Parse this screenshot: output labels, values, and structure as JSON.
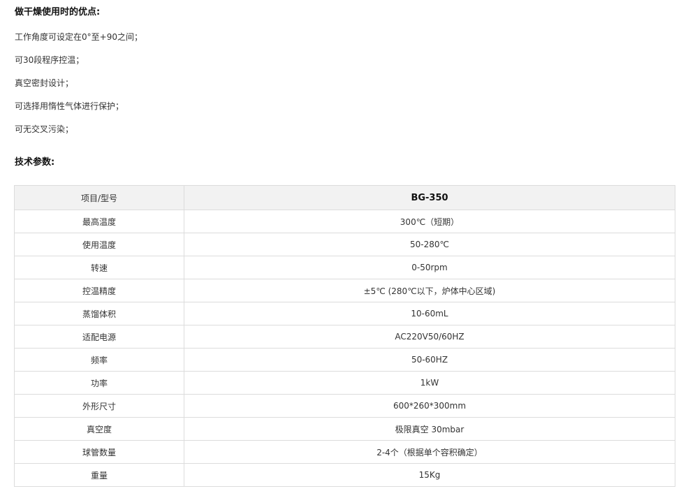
{
  "advantages": {
    "title": "做干燥使用时的优点:",
    "items": [
      "工作角度可设定在0°至+90之间；",
      "可30段程序控温；",
      "真空密封设计；",
      "可选择用惰性气体进行保护；",
      "可无交叉污染；"
    ]
  },
  "specs": {
    "title": "技术参数:",
    "header": {
      "label": "项目/型号",
      "model": "BG-350"
    },
    "rows": [
      {
        "label": "最高温度",
        "value": "300℃（短期）"
      },
      {
        "label": "使用温度",
        "value": "50-280℃"
      },
      {
        "label": "转速",
        "value": "0-50rpm"
      },
      {
        "label": "控温精度",
        "value": "±5℃ (280℃以下，炉体中心区域)"
      },
      {
        "label": "蒸馏体积",
        "value": "10-60mL"
      },
      {
        "label": "适配电源",
        "value": "AC220V50/60HZ"
      },
      {
        "label": "频率",
        "value": "50-60HZ"
      },
      {
        "label": "功率",
        "value": "1kW"
      },
      {
        "label": "外形尺寸",
        "value": "600*260*300mm"
      },
      {
        "label": "真空度",
        "value": "极限真空 30mbar"
      },
      {
        "label": "球管数量",
        "value": "2-4个（根据单个容积确定）"
      },
      {
        "label": "重量",
        "value": "15Kg"
      }
    ]
  }
}
